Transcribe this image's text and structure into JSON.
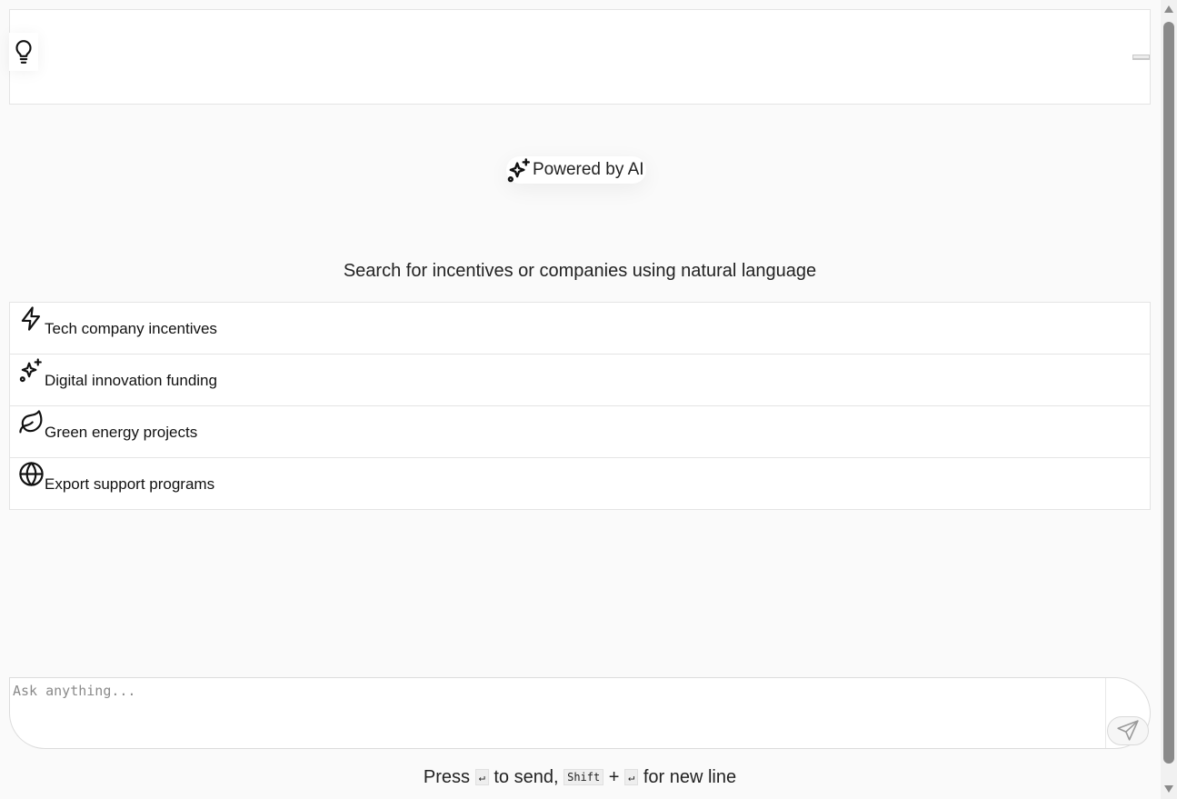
{
  "header": {
    "icon": "lightbulb-icon"
  },
  "badge": {
    "icon": "sparkles-icon",
    "label": "Powered by AI"
  },
  "subtitle": "Search for incentives or companies using natural language",
  "suggestions": [
    {
      "icon": "zap-icon",
      "label": "Tech company incentives"
    },
    {
      "icon": "sparkles-icon",
      "label": "Digital innovation funding"
    },
    {
      "icon": "leaf-icon",
      "label": "Green energy projects"
    },
    {
      "icon": "globe-icon",
      "label": "Export support programs"
    }
  ],
  "chat_input": {
    "placeholder": "Ask anything...",
    "value": ""
  },
  "send_button": {
    "icon": "send-icon"
  },
  "hint": {
    "press": "Press",
    "enter_key": "↵",
    "to_send": "to send,",
    "shift_key": "Shift",
    "plus": "+",
    "enter_key_2": "↵",
    "new_line": "for new line"
  }
}
